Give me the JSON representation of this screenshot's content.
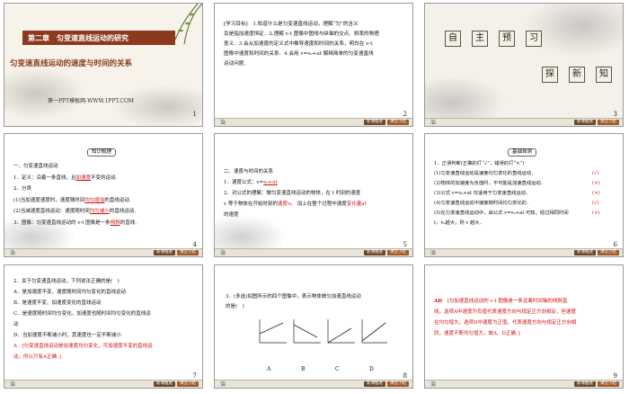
{
  "slides": [
    {
      "num": "1",
      "chapter": "第二章　匀变速直线运动的研究",
      "subtitle": "匀变速直线运动的速度与时间的关系",
      "site": "第一PPT模板网-WWW.1PPT.COM"
    },
    {
      "num": "2",
      "lines": [
        "[学习目标]　1.知道什么是匀变速直线运动，理解“匀”的含义",
        "及是指加速度恒定．2.理解 v­-t 图像中图线与纵轴的交点、斜率的物理",
        "意义．3.会从加速度的定义式中推导速度和时间的关系，明白在 v­-t",
        "图像中速度和时间的关系．4.会用 v=v₀+at 解释简单的匀变速直线",
        "运动问题．"
      ]
    },
    {
      "num": "3",
      "tiles_top": [
        "自",
        "主",
        "预",
        "习"
      ],
      "tiles_bottom": [
        "探",
        "新",
        "知"
      ]
    },
    {
      "num": "4",
      "badge": "知识梳理",
      "lines": [
        "一、匀变速直线运动",
        "1．定义：沿着一条直线，且",
        "2．分类",
        "(1)当加速度速度时，速度随时间",
        "(2)当减速度直线运动：速度随时间",
        "3．图像：匀变速直线运动的 v-t 图像是一条"
      ],
      "answers": [
        "加速度",
        "均匀增加",
        "均匀减小",
        "倾斜"
      ],
      "tails": [
        "不变的运动.",
        "的直线运动.",
        "的直线运动.",
        "的直线."
      ]
    },
    {
      "num": "5",
      "lines": [
        "二、速度与时间的关系",
        "1．速度公式：v=",
        "2．对公式的理解：做匀变速直线运动的物体，在 t 时刻的速度",
        "v 等于物体在开始时刻的",
        "的速度"
      ],
      "answers": [
        "v₀+at",
        "速度v₀",
        "变化量at"
      ],
      "mid": "加上在整个过程中速度"
    },
    {
      "num": "6",
      "badge": "基础自测",
      "lines": [
        "1．正误判断(正确的打“√”，错误的打“×”)",
        "(1)匀变速直线运动是速度均匀变化的直线运动．",
        "(2)物体的加速度为负值时，不可能是加速直线运动．",
        "(3)公式 v=v₀+at 仅适用于匀变速直线运动．",
        "(4)匀变速直线运动中速度随时间均匀变化的．",
        "(5)在匀变速直线运动中，由公式 v=v₀+at 可知，经过相同时间",
        "t，v₀越大，则 v 越大．"
      ],
      "marks": [
        "(√)",
        "(×)",
        "(×)",
        "(√)",
        "(×)"
      ]
    },
    {
      "num": "7",
      "lines": [
        "2．关于匀变速直线运动，下列说法正确的是(　)",
        "A．是加速度不变、速度随时间均匀变化的直线运动",
        "B．是速度不变、加速度变化的直线运动",
        "C．是速度随时间均匀变化、加速度也随时间均匀变化的直线运",
        "动",
        "D．当加速度不断减小时，其速度也一定不断减小"
      ],
      "answer": "A　[匀变速直线运动是加速度均匀变化，可加速度不变的直线运",
      "answer2": "动，所以只有A正确．]"
    },
    {
      "num": "8",
      "lines": [
        "3．(多选)如图所示的四个图像中，表示物体做匀加速直线运动",
        "的是(　)"
      ],
      "graph_labels": [
        "A",
        "B",
        "C",
        "D"
      ],
      "axis_v": "v",
      "axis_t": "t",
      "axis_o": "O"
    },
    {
      "num": "9",
      "answer_key": "AD",
      "lines": [
        "[匀加速直线运动的 v-t 图像是一条远离时间轴的倾斜直",
        "线，选项A中速度为负值代表速度方向与规定正方向相反，但速度",
        "在均匀增大，选项D中速度为正值，代表速度方向与规定正方向相",
        "同，速度不断均匀增大，故A、D正确．]"
      ]
    }
  ],
  "footer": {
    "left": "治",
    "btn1": "新课推进",
    "btn2": "课堂小结"
  },
  "colors": {
    "title_bar": "#8b3a1e",
    "answer_red": "#d01010",
    "footer_bg": "#e8e4da"
  }
}
